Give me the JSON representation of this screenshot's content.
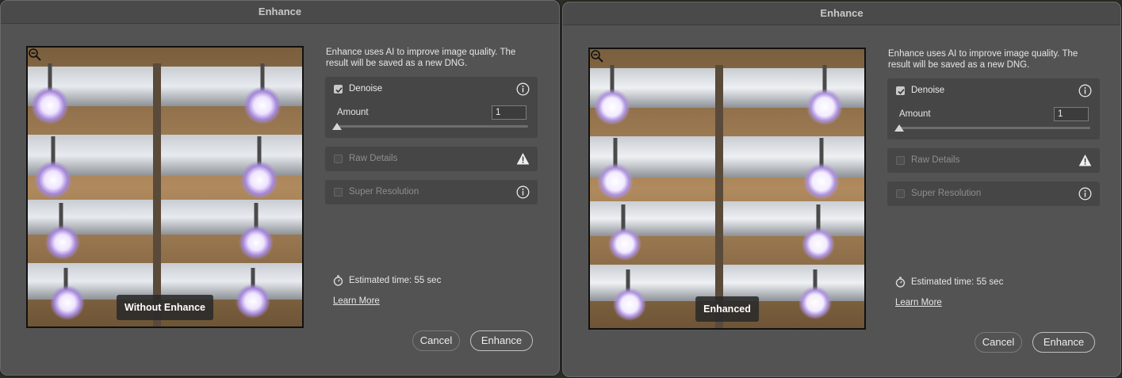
{
  "dialogs": [
    {
      "title": "Enhance",
      "preview_label": "Without Enhance",
      "description": "Enhance uses AI to improve image quality. The result will be saved as a new DNG.",
      "denoise": {
        "label": "Denoise",
        "checked": true,
        "amount_label": "Amount",
        "amount_value": "1"
      },
      "raw_details": {
        "label": "Raw Details",
        "checked": false,
        "enabled": false
      },
      "super_resolution": {
        "label": "Super Resolution",
        "checked": false,
        "enabled": false
      },
      "estimated_time": "Estimated time: 55 sec",
      "learn_more": "Learn More",
      "cancel_label": "Cancel",
      "enhance_label": "Enhance"
    },
    {
      "title": "Enhance",
      "preview_label": "Enhanced",
      "description": "Enhance uses AI to improve image quality. The result will be saved as a new DNG.",
      "denoise": {
        "label": "Denoise",
        "checked": true,
        "amount_label": "Amount",
        "amount_value": "1"
      },
      "raw_details": {
        "label": "Raw Details",
        "checked": false,
        "enabled": false
      },
      "super_resolution": {
        "label": "Super Resolution",
        "checked": false,
        "enabled": false
      },
      "estimated_time": "Estimated time: 55 sec",
      "learn_more": "Learn More",
      "cancel_label": "Cancel",
      "enhance_label": "Enhance"
    }
  ],
  "icons": {
    "denoise_info": "info-icon",
    "raw_details_warning": "warning-icon",
    "super_resolution_info": "info-icon",
    "estimated_time": "stopwatch-icon",
    "preview_zoom": "zoom-out-icon"
  },
  "colors": {
    "dialog_bg": "#535353",
    "panel_bg": "#464646",
    "text": "#e6e6e6",
    "disabled_text": "#8e8e8e"
  }
}
